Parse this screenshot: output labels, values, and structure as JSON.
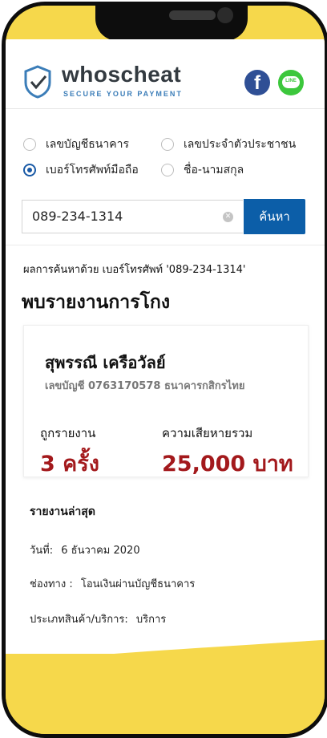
{
  "brand": {
    "name": "whoscheat",
    "tagline": "SECURE YOUR PAYMENT",
    "colors": {
      "yellow": "#f6d84b",
      "blue": "#0c5ea8",
      "red": "#a3191c"
    }
  },
  "social": {
    "facebook_icon": "facebook-icon",
    "line_icon": "line-icon",
    "line_label": "LINE"
  },
  "search_types": [
    {
      "label": "เลขบัญชีธนาคาร",
      "selected": false
    },
    {
      "label": "เลขประจำตัวประชาชน",
      "selected": false
    },
    {
      "label": "เบอร์โทรศัพท์มือถือ",
      "selected": true
    },
    {
      "label": "ชื่อ-นามสกุล",
      "selected": false
    }
  ],
  "search": {
    "value": "089-234-1314",
    "button_label": "ค้นหา"
  },
  "result": {
    "summary": "ผลการค้นหาด้วย เบอร์โทรศัพท์ '089-234-1314'",
    "found_title": "พบรายงานการโกง",
    "card": {
      "name": "สุพรรณี เครือวัลย์",
      "account": "เลขบัญชี 0763170578 ธนาคารกสิกรไทย",
      "reported_label": "ถูกรายงาน",
      "reported_value": "3 ครั้ง",
      "damage_label": "ความเสียหายรวม",
      "damage_value": "25,000 บาท"
    },
    "latest": {
      "title": "รายงานล่าสุด",
      "date_label": "วันที่:",
      "date_value": "6 ธันวาคม 2020",
      "channel_label": "ช่องทาง :",
      "channel_value": "โอนเงินผ่านบัญชีธนาคาร",
      "type_label": "ประเภทสินค้า/บริการ:",
      "type_value": "บริการ"
    }
  }
}
